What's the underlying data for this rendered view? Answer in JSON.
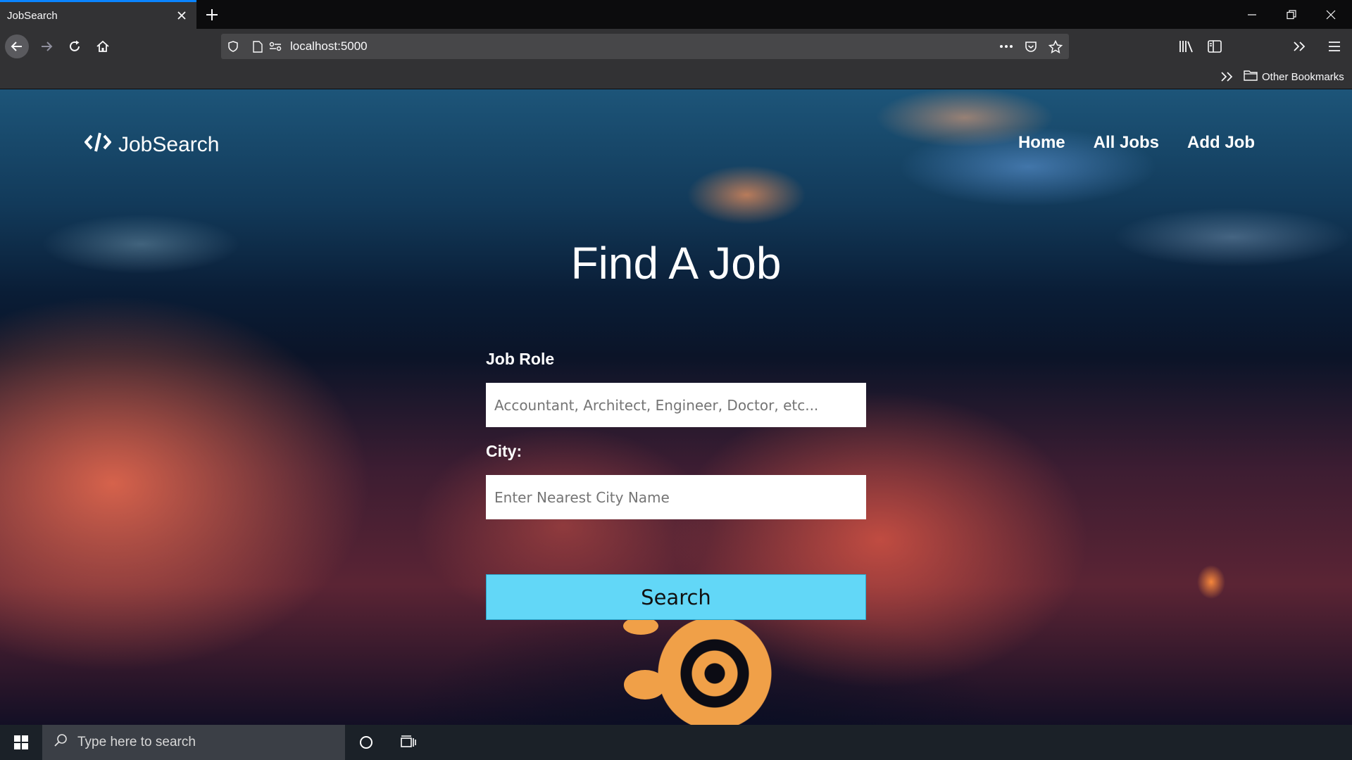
{
  "browser": {
    "tab_title": "JobSearch",
    "url": "localhost:5000",
    "bookmarks_folder": "Other Bookmarks"
  },
  "site": {
    "brand": "JobSearch",
    "nav": [
      "Home",
      "All Jobs",
      "Add Job"
    ]
  },
  "hero": {
    "title": "Find A Job"
  },
  "form": {
    "job_role_label": "Job Role",
    "job_role_placeholder": "Accountant, Architect, Engineer, Doctor, etc...",
    "city_label": "City:",
    "city_placeholder": "Enter Nearest City Name",
    "submit_label": "Search"
  },
  "taskbar": {
    "search_placeholder": "Type here to search"
  },
  "colors": {
    "accent_tab": "#0a84ff",
    "search_button": "#62d7f7"
  }
}
